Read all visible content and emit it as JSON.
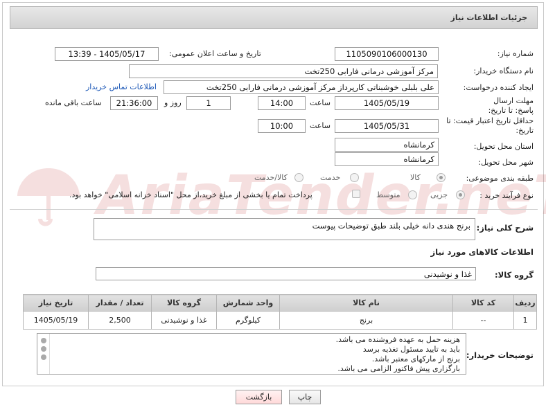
{
  "header": {
    "title": "جزئیات اطلاعات نیاز"
  },
  "fields": {
    "need_number_label": "شماره نیاز:",
    "need_number": "1105090106000130",
    "announce_label": "تاریخ و ساعت اعلان عمومی:",
    "announce_value": "1405/05/17 - 13:39",
    "buyer_org_label": "نام دستگاه خریدار:",
    "buyer_org": "مرکز آموزشی  درمانی فارابی 250تخت",
    "creator_label": "ایجاد کننده درخواست:",
    "creator": "علی بلبلی خوشبناتی کارپرداز مرکز آموزشی  درمانی فارابی 250تخت",
    "contact_link": "اطلاعات تماس خریدار",
    "deadline_label": "مهلت ارسال پاسخ: تا تاریخ:",
    "deadline_date": "1405/05/19",
    "time_label": "ساعت",
    "deadline_time": "14:00",
    "days_value": "1",
    "days_label": "روز و",
    "remaining_value": "21:36:00",
    "remaining_label": "ساعت باقی مانده",
    "price_validity_label": "حداقل تاریخ اعتبار قیمت: تا تاریخ:",
    "price_validity_date": "1405/05/31",
    "price_validity_time": "10:00",
    "province_label": "استان محل تحویل:",
    "province": "کرمانشاه",
    "city_label": "شهر محل تحویل:",
    "city": "کرمانشاه",
    "category_label": "طبقه بندی موضوعی:",
    "category_options": [
      "کالا",
      "خدمت",
      "کالا/خدمت"
    ],
    "process_label": "نوع فرآیند خرید :",
    "process_options": [
      "جزیی",
      "متوسط"
    ],
    "payment_note": "پرداخت تمام یا بخشی از مبلغ خرید،از محل \"اسناد خزانه اسلامی\" خواهد بود."
  },
  "description": {
    "label": "شرح کلی نیاز:",
    "value": "برنج هندی دانه خیلی بلند طبق توضیحات پیوست"
  },
  "goods": {
    "section_title": "اطلاعات کالاهای مورد نیاز",
    "group_label": "گروه کالا:",
    "group_value": "غذا و نوشیدنی",
    "columns": [
      "ردیف",
      "کد کالا",
      "نام کالا",
      "واحد شمارش",
      "گروه کالا",
      "تعداد / مقدار",
      "تاریخ نیاز"
    ],
    "rows": [
      [
        "1",
        "--",
        "برنج",
        "کیلوگرم",
        "غذا و نوشیدنی",
        "2,500",
        "1405/05/19"
      ]
    ]
  },
  "buyer_notes": {
    "label": "توضیحات خریدار:",
    "lines": [
      "هزینه حمل به عهده فروشنده می باشد.",
      "باید به تایید مسئول تغذیه برسد",
      "برنج از مارکهای معتبر باشد.",
      "بارگزاری پیش فاکتور الزامی می باشد."
    ]
  },
  "buttons": {
    "print": "چاپ",
    "back": "بازگشت"
  },
  "watermark": {
    "text": "AriaTender.neT"
  },
  "colors": {
    "link": "#1a56b6",
    "watermark": "#b00000",
    "back_button": "#ffd9d9"
  }
}
